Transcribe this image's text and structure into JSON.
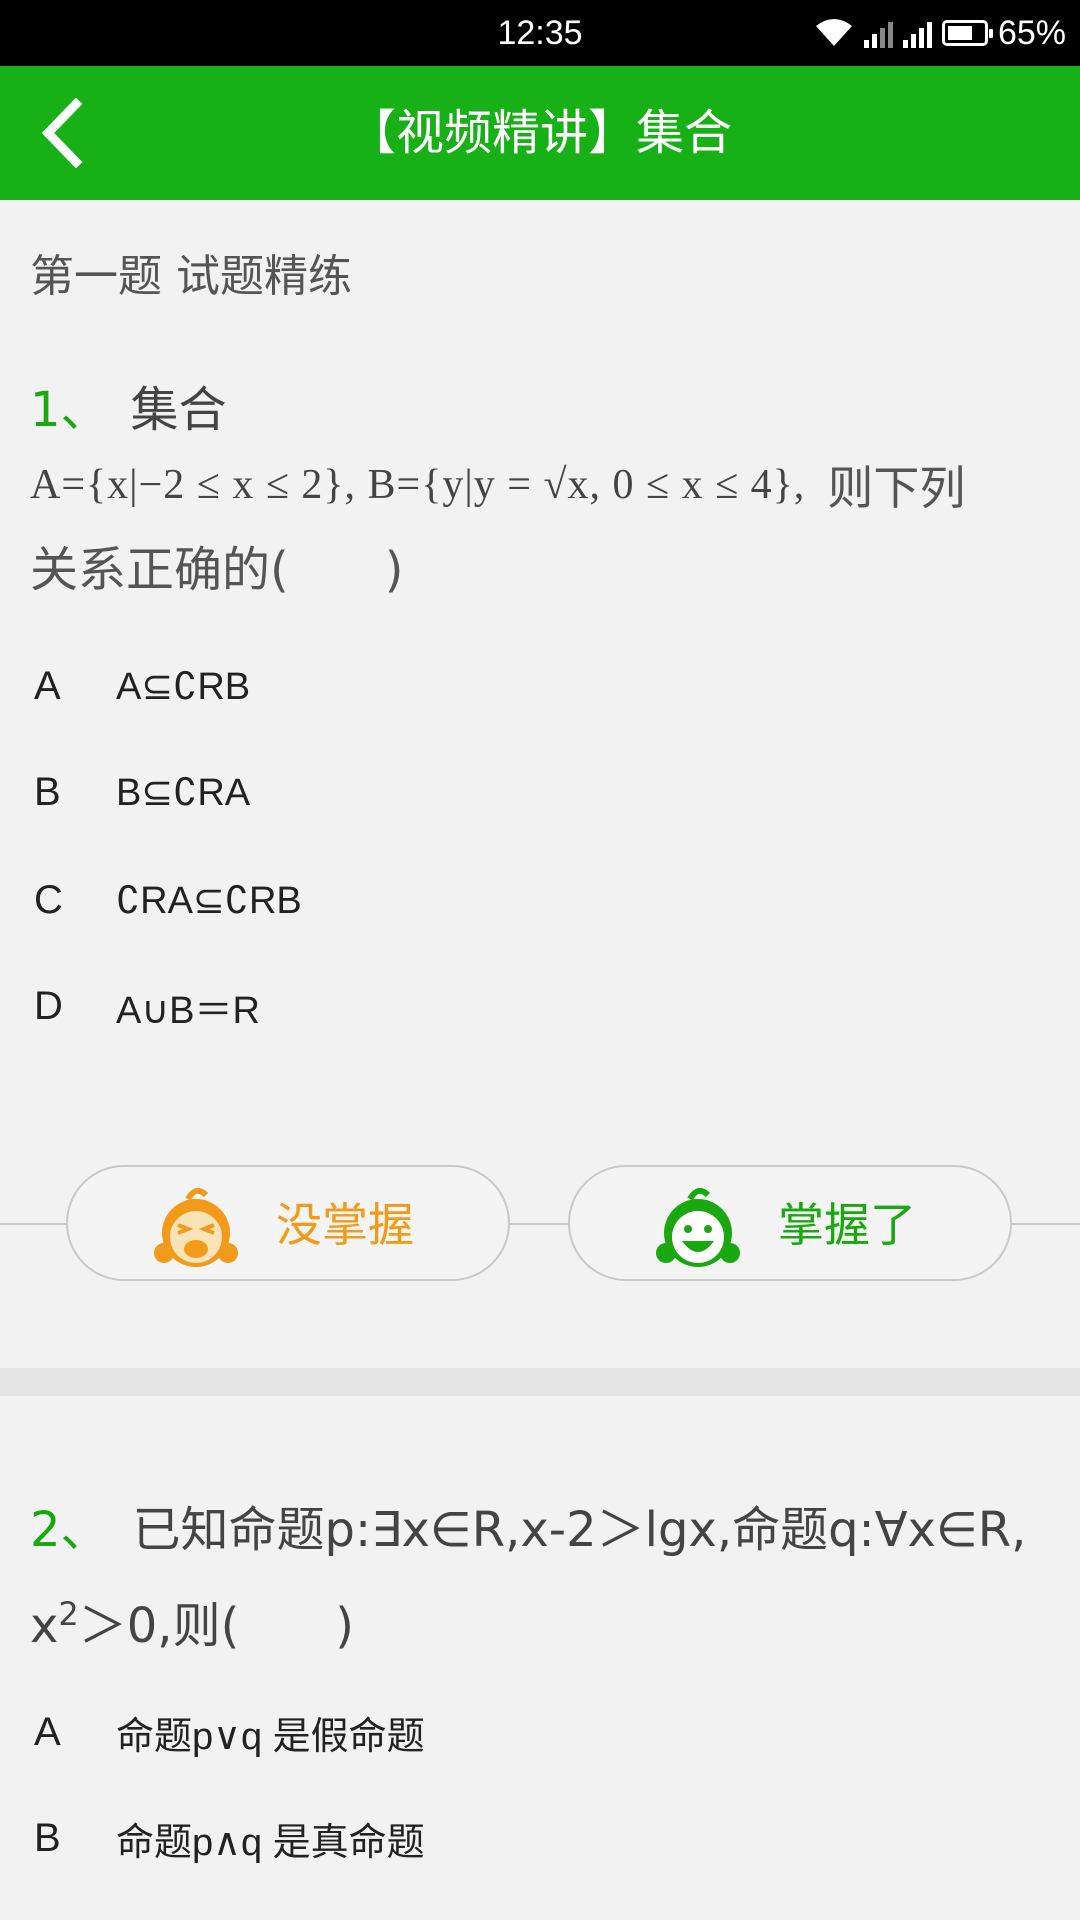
{
  "status_bar": {
    "time": "12:35",
    "battery_percent": "65%",
    "icons": [
      "wifi-icon",
      "signal-icon",
      "signal-icon",
      "battery-icon"
    ]
  },
  "header": {
    "title": "【视频精讲】集合",
    "back_icon": "chevron-left-icon",
    "background_color": "#17b117"
  },
  "section": {
    "title": "第一题 试题精练"
  },
  "question1": {
    "number": "1、",
    "topic": "集合",
    "formula": "A={x|−2 ≤ x ≤ 2}, B={y|y = √x, 0 ≤ x ≤ 4},",
    "text_tail": "则下列",
    "text_line2": "关系正确的(　　)",
    "options": [
      {
        "letter": "A",
        "text": "A⊆∁RB"
      },
      {
        "letter": "B",
        "text": "B⊆∁RA"
      },
      {
        "letter": "C",
        "text": "∁RA⊆∁RB"
      },
      {
        "letter": "D",
        "text": "A∪B＝R"
      }
    ]
  },
  "feedback": {
    "not_mastered": "没掌握",
    "mastered": "掌握了",
    "not_mastered_color": "#f29b1a",
    "mastered_color": "#19a80f"
  },
  "question2": {
    "number": "2、",
    "text_part1": "已知命题p:∃x∈R,x-2＞lgx,命题q:∀x∈R, x",
    "superscript": "2",
    "text_part2": "＞0,则(　　)",
    "options": [
      {
        "letter": "A",
        "text": "命题p∨q 是假命题"
      },
      {
        "letter": "B",
        "text": "命题p∧q 是真命题"
      }
    ]
  }
}
